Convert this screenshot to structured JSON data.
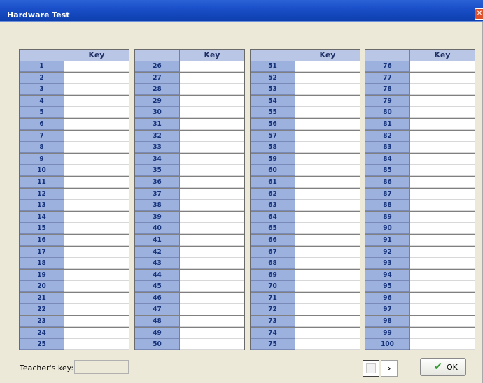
{
  "window": {
    "title": "Hardware Test",
    "close_glyph": "✕"
  },
  "columns": [
    {
      "header_num": "",
      "header_key": "Key",
      "numbers": [
        "1",
        "2",
        "3",
        "4",
        "5",
        "6",
        "7",
        "8",
        "9",
        "10",
        "11",
        "12",
        "13",
        "14",
        "15",
        "16",
        "17",
        "18",
        "19",
        "20",
        "21",
        "22",
        "23",
        "24",
        "25"
      ]
    },
    {
      "header_num": "",
      "header_key": "Key",
      "numbers": [
        "26",
        "27",
        "28",
        "29",
        "30",
        "31",
        "32",
        "33",
        "34",
        "35",
        "36",
        "37",
        "38",
        "39",
        "40",
        "41",
        "42",
        "43",
        "44",
        "45",
        "46",
        "47",
        "48",
        "49",
        "50"
      ]
    },
    {
      "header_num": "",
      "header_key": "Key",
      "numbers": [
        "51",
        "52",
        "53",
        "54",
        "55",
        "56",
        "57",
        "58",
        "59",
        "60",
        "61",
        "62",
        "63",
        "64",
        "65",
        "66",
        "67",
        "68",
        "69",
        "70",
        "71",
        "72",
        "73",
        "74",
        "75"
      ]
    },
    {
      "header_num": "",
      "header_key": "Key",
      "numbers": [
        "76",
        "77",
        "78",
        "79",
        "80",
        "81",
        "82",
        "83",
        "84",
        "85",
        "86",
        "87",
        "88",
        "89",
        "90",
        "91",
        "92",
        "93",
        "94",
        "95",
        "96",
        "97",
        "98",
        "99",
        "100"
      ]
    }
  ],
  "footer": {
    "teacher_key_label": "Teacher's key:",
    "teacher_key_value": "",
    "next_label": "›",
    "ok_icon": "check-icon",
    "ok_label": "OK"
  },
  "colors": {
    "titlebar": "#0d3fae",
    "header_bg": "#b9c6e6",
    "number_cell_bg": "#9db1df",
    "ok_check": "#2f9e2f"
  }
}
